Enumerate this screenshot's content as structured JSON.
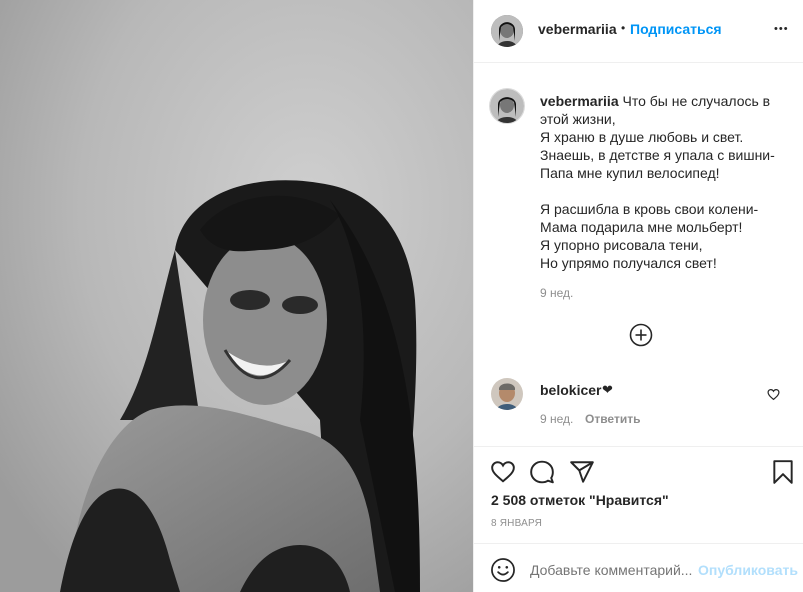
{
  "post": {
    "username": "vebermariia",
    "follow_dot": "•",
    "follow_label": "Подписаться",
    "more_label": "•••",
    "caption_username": "vebermariia",
    "caption_first": "Что бы не случалось в",
    "caption_lines": [
      "этой жизни,",
      "Я храню в душе любовь и свет.",
      "Знаешь, в детстве я упала с вишни-",
      "Папа мне купил велосипед!",
      "",
      "Я расшибла в кровь свои колени-",
      "Мама подарила мне мольберт!",
      "Я упорно рисовала тени,",
      "Но упрямо получался свет!"
    ],
    "caption_time": "9 нед.",
    "comment": {
      "username": "belokicer",
      "text": "❤",
      "time": "9 нед.",
      "reply_label": "Ответить"
    },
    "likes_label": "2 508 отметок \"Нравится\"",
    "date_label": "8 ЯНВАРЯ",
    "comment_placeholder": "Добавьте комментарий...",
    "publish_label": "Опубликовать"
  },
  "colors": {
    "accent": "#0095f6",
    "publish_disabled": "#b2dffc",
    "muted": "#8e8e8e",
    "text": "#262626"
  },
  "icons": [
    "heart-icon",
    "comment-icon",
    "share-icon",
    "bookmark-icon",
    "more-icon",
    "load-more-icon",
    "like-comment-icon",
    "emoji-icon"
  ]
}
